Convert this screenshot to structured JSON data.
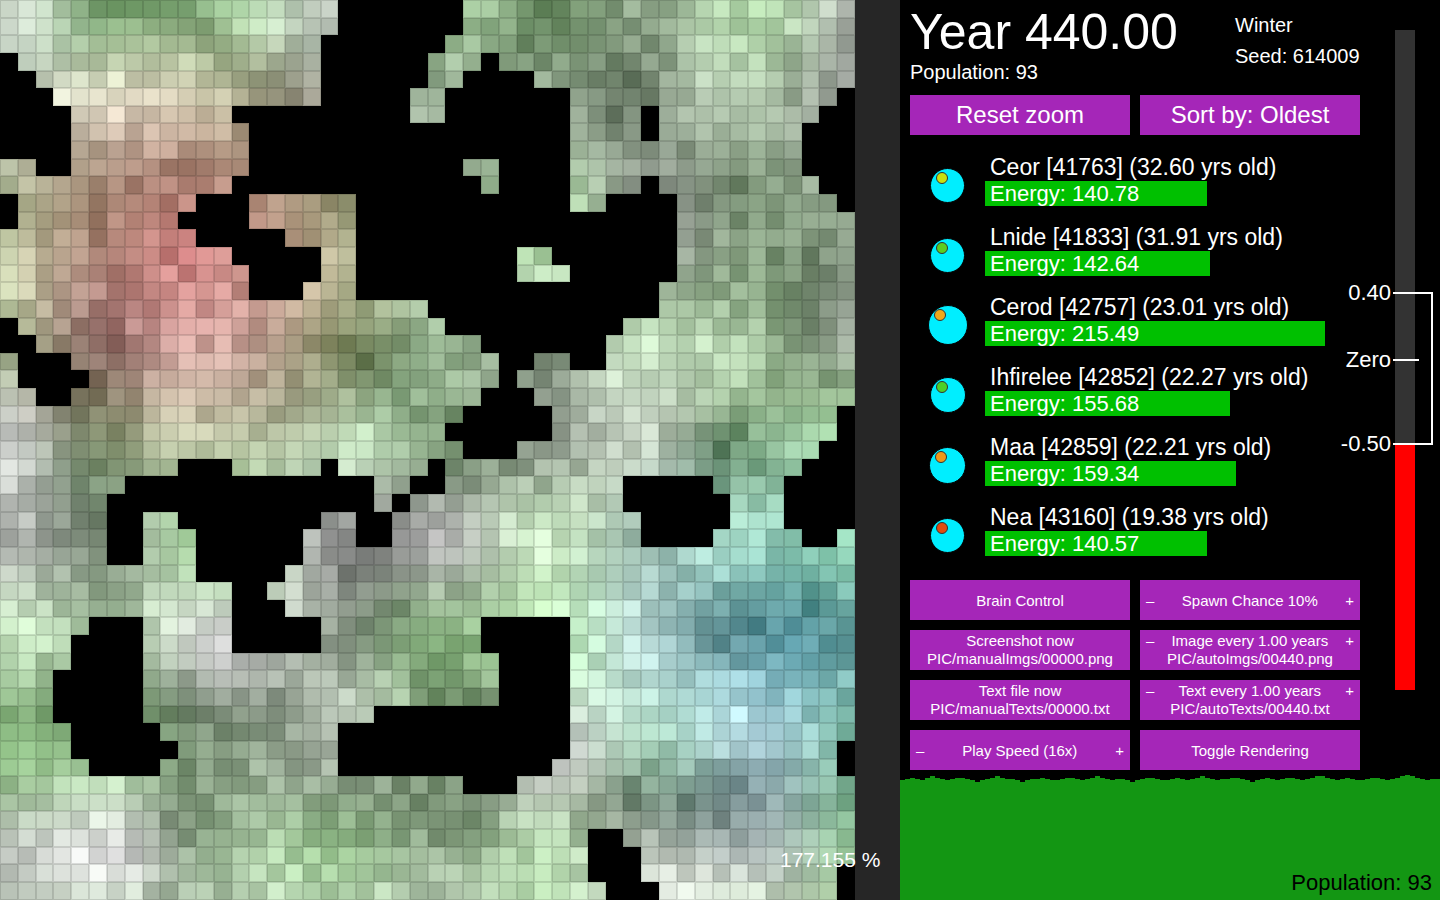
{
  "header": {
    "year": "Year 440.00",
    "population": "Population: 93",
    "season": "Winter",
    "seed": "Seed: 614009"
  },
  "map": {
    "zoom": "177.155 %"
  },
  "top_buttons": [
    "Reset zoom",
    "Sort by: Oldest"
  ],
  "creatures": [
    {
      "name": "Ceor [41763] (32.60 yrs old)",
      "energy": "Energy: 140.78",
      "level": 0.584,
      "color": "#c8e010"
    },
    {
      "name": "Lnide [41833] (31.91 yrs old)",
      "energy": "Energy: 142.64",
      "level": 0.592,
      "color": "#5ccc20"
    },
    {
      "name": "Cerod [42757] (23.01 yrs old)",
      "energy": "Energy: 215.49",
      "level": 0.895,
      "color": "#f0a818"
    },
    {
      "name": "Ihfirelee [42852] (22.27 yrs old)",
      "energy": "Energy: 155.68",
      "level": 0.645,
      "color": "#4cd028"
    },
    {
      "name": "Maa [42859] (22.21 yrs old)",
      "energy": "Energy: 159.34",
      "level": 0.66,
      "color": "#f09818"
    },
    {
      "name": "Nea [43160] (19.38 yrs old)",
      "energy": "Energy: 140.57",
      "level": 0.584,
      "color": "#e04c10"
    }
  ],
  "controls": [
    {
      "kind": "button",
      "label": "Brain Control"
    },
    {
      "kind": "stepper",
      "minus": "–",
      "label": "Spawn Chance 10%",
      "plus": "+"
    },
    {
      "kind": "file",
      "label": "Screenshot now",
      "path": "PIC/manualImgs/00000.png"
    },
    {
      "kind": "file-stepper",
      "minus": "–",
      "label": "Image every 1.00 years",
      "plus": "+",
      "path": "PIC/autoImgs/00440.png"
    },
    {
      "kind": "file",
      "label": "Text file now",
      "path": "PIC/manualTexts/00000.txt"
    },
    {
      "kind": "file-stepper",
      "minus": "–",
      "label": "Text every 1.00 years",
      "plus": "+",
      "path": "PIC/autoTexts/00440.txt"
    },
    {
      "kind": "stepper",
      "minus": "–",
      "label": "Play Speed (16x)",
      "plus": "+"
    },
    {
      "kind": "button",
      "label": "Toggle Rendering"
    }
  ],
  "temperature": {
    "level": 0.374,
    "ticks": [
      {
        "label": "0.40",
        "value": 0.4
      },
      {
        "label": "Zero",
        "value": 0
      },
      {
        "label": "-0.50",
        "value": -0.5
      }
    ]
  },
  "population_chart": {
    "label": "Population: 93",
    "values": [
      92,
      93,
      94,
      93,
      92,
      94,
      95,
      94,
      93,
      92,
      93,
      94,
      94,
      93,
      92,
      91,
      92,
      93,
      94,
      95,
      94,
      93,
      93,
      92,
      91,
      92,
      93,
      93,
      94,
      93,
      92,
      92,
      93,
      94,
      94,
      93,
      92,
      93,
      94,
      95,
      94,
      93,
      92,
      93,
      93,
      92,
      91,
      92,
      93,
      94,
      94,
      93,
      92,
      92,
      93,
      94,
      93,
      92,
      93,
      94,
      95,
      94,
      93,
      92,
      93,
      93,
      94,
      94,
      93,
      92,
      91,
      92,
      93,
      94,
      93,
      92,
      93,
      94,
      94,
      93,
      92,
      93,
      94,
      95,
      95,
      94,
      93,
      92,
      93,
      94,
      93,
      92,
      92,
      93,
      94,
      94,
      93,
      92,
      93,
      94,
      95,
      96,
      95,
      94,
      93,
      92,
      93,
      93
    ]
  }
}
